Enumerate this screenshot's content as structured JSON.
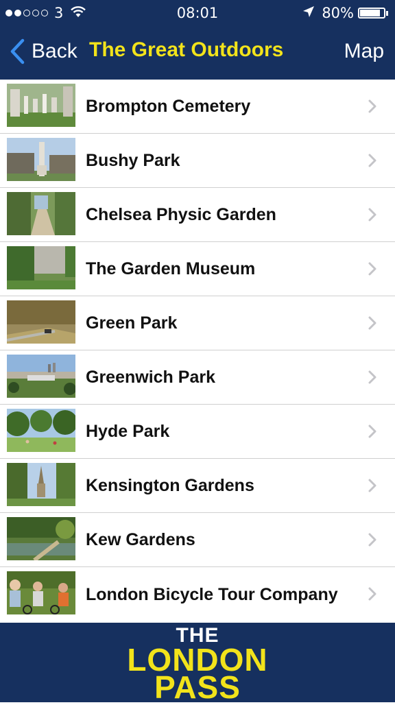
{
  "status_bar": {
    "carrier": "3",
    "time": "08:01",
    "battery": "80%",
    "battery_level": 0.8,
    "signal_bars_filled": 2,
    "signal_bars_total": 5
  },
  "nav": {
    "back_label": "Back",
    "title": "The Great Outdoors",
    "map_label": "Map"
  },
  "items": [
    {
      "label": "Brompton Cemetery"
    },
    {
      "label": "Bushy Park"
    },
    {
      "label": "Chelsea Physic Garden"
    },
    {
      "label": "The Garden Museum"
    },
    {
      "label": "Green Park"
    },
    {
      "label": "Greenwich Park"
    },
    {
      "label": "Hyde Park"
    },
    {
      "label": "Kensington Gardens"
    },
    {
      "label": "Kew Gardens"
    },
    {
      "label": "London Bicycle Tour Company"
    }
  ],
  "footer": {
    "logo_line1": "THE",
    "logo_line2": "LONDON",
    "logo_line3": "PASS"
  },
  "colors": {
    "nav_background": "#16305f",
    "title_accent": "#f2e31b"
  }
}
